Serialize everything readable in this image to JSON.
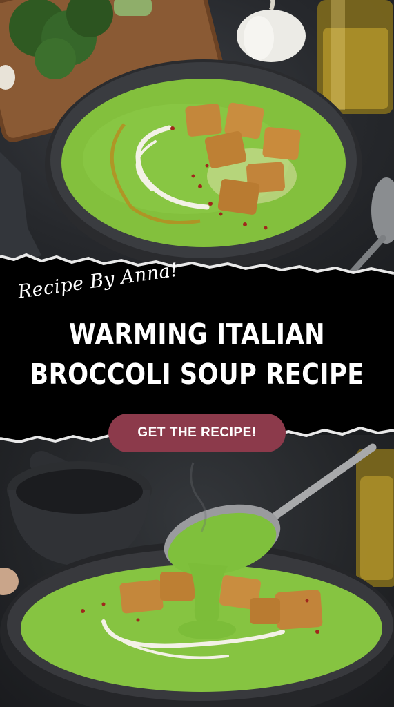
{
  "pin": {
    "byline": "Recipe By Anna!",
    "title_line_1": "WARMING ITALIAN",
    "title_line_2": "BROCCOLI SOUP RECIPE",
    "cta_label": "GET THE RECIPE!"
  },
  "colors": {
    "banner_background": "#000000",
    "cta_background": "#8c3a4b",
    "text": "#ffffff",
    "soup_green": "#7fbf3a"
  }
}
